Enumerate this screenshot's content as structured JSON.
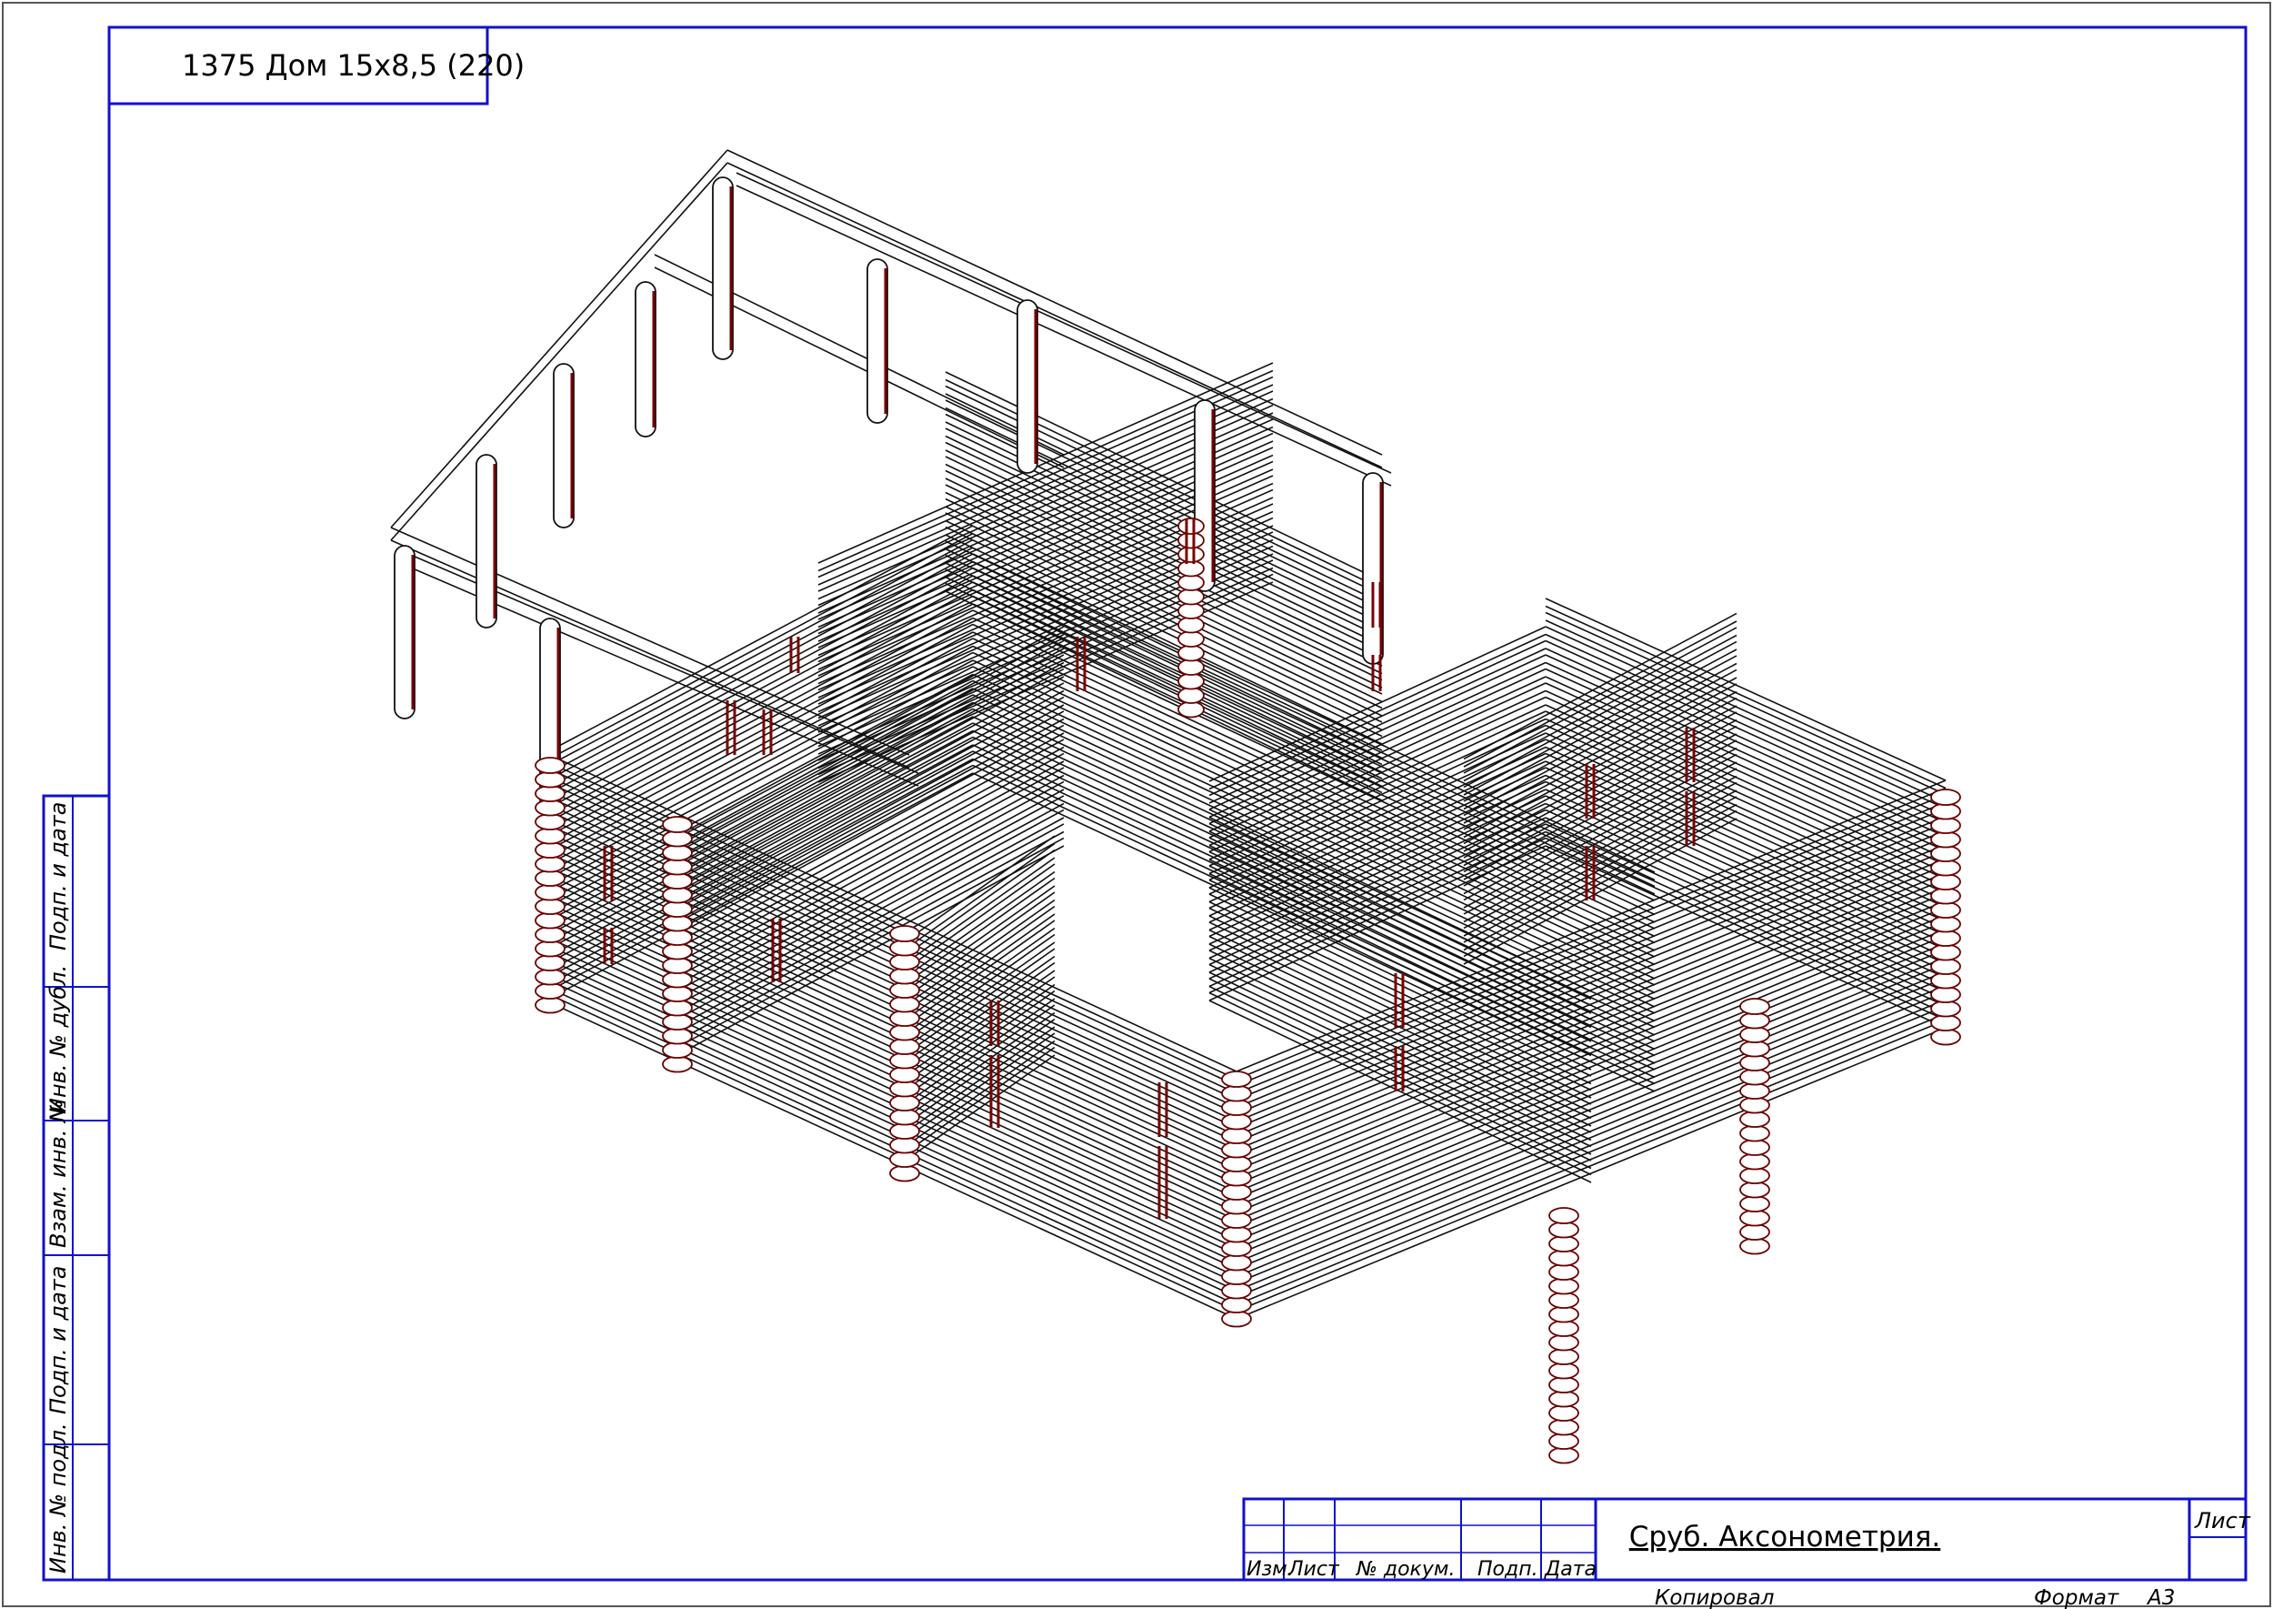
{
  "drawing": {
    "code": "1375 Дом 15х8,5 (220)",
    "sheet_title": "Сруб. Аксонометрия.",
    "sheet_label": "Лист",
    "copied_by_label": "Копировал",
    "format_label": "Формат",
    "format_value": "А3"
  },
  "side_stamp": [
    "Подп. и дата",
    "Инв. № дубл.",
    "Взам. инв. №",
    "Подп. и дата",
    "Инв. № подл."
  ],
  "title_block": {
    "columns": [
      "Изм.",
      "Лист",
      "№ докум.",
      "Подп.",
      "Дата"
    ]
  },
  "colors": {
    "frame": "#1111cc",
    "lines": "#111111",
    "log_ends": "#7a0000"
  }
}
